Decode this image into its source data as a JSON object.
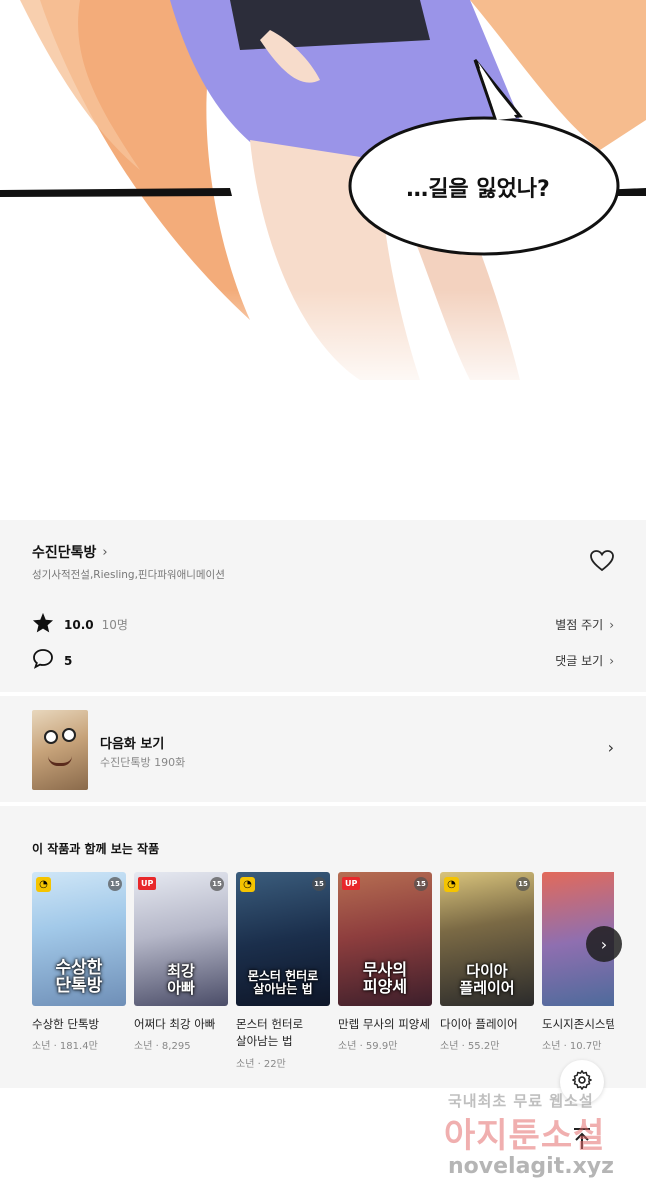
{
  "comic": {
    "speech_bubble": "…길을 잃었나?"
  },
  "series": {
    "title": "수진단톡방",
    "authors": "성기사적전설,Riesling,핀다파워애니메이션",
    "rating": "10.0",
    "rating_count": "10명",
    "rate_link": "별점 주기",
    "comment_count": "5",
    "comment_link": "댓글 보기"
  },
  "next_episode": {
    "label": "다음화 보기",
    "subtitle": "수진단톡방 190화"
  },
  "recommendations": {
    "heading": "이 작품과 함께 보는 작품",
    "items": [
      {
        "title": "수상한 단톡방",
        "meta": "소년 · 181.4만",
        "badge": "clock",
        "age": "15",
        "cover_text": "수상한\n단톡방",
        "cover_color": "#a2c9e9"
      },
      {
        "title": "어쩌다 최강 아빠",
        "meta": "소년 · 8,295",
        "badge": "UP",
        "age": "15",
        "cover_text": "최강\n아빠",
        "cover_color": "#b5b7c8"
      },
      {
        "title": "몬스터 헌터로 살아남는 법",
        "meta": "소년 · 22만",
        "badge": "clock",
        "age": "15",
        "cover_text": "몬스터 헌터로\n살아남는 법",
        "cover_color": "#1b2f4c"
      },
      {
        "title": "만렙 무사의 피양세",
        "meta": "소년 · 59.9만",
        "badge": "UP",
        "age": "15",
        "cover_text": "무사의\n피양세",
        "cover_color": "#8e3e3e"
      },
      {
        "title": "다이아 플레이어",
        "meta": "소년 · 55.2만",
        "badge": "clock",
        "age": "15",
        "cover_text": "다이아\n플레이어",
        "cover_color": "#7b6a45"
      },
      {
        "title": "도시지존시스템",
        "meta": "소년 · 10.7만",
        "badge": "",
        "age": "",
        "cover_text": "",
        "cover_color": "#8f6fb0"
      }
    ]
  },
  "watermark": {
    "line1": "국내최초 무료 웹소설",
    "line2": "아지툰소설",
    "line3": "novelagit.xyz"
  },
  "icons": {
    "star": "star-icon",
    "comment": "comment-bubble-icon",
    "heart": "heart-outline-icon",
    "gear": "gear-icon",
    "scroll_top": "arrow-up-icon",
    "next": "chevron-right-icon"
  }
}
